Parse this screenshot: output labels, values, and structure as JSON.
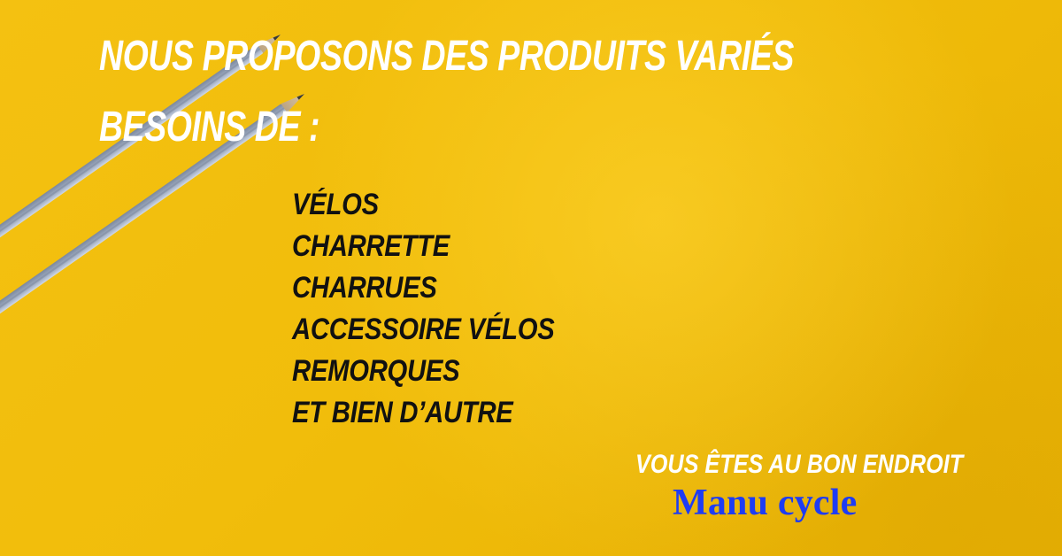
{
  "page": {
    "background_color": "#f2bd0c"
  },
  "header": {
    "line_1": "NOUS PROPOSONS DES PRODUITS VARIÉS",
    "line_2": "BESOINS DE :"
  },
  "products": [
    "VÉLOS",
    "CHARRETTE",
    "CHARRUES",
    "ACCESSOIRE VÉLOS",
    "REMORQUES",
    "ET BIEN D’AUTRE"
  ],
  "footer": {
    "tagline": "VOUS ÊTES AU BON ENDROIT",
    "brand": "Manu cycle",
    "brand_color": "#1e3cf4"
  },
  "decor": {
    "pencil_icon": "pencil-icon"
  }
}
